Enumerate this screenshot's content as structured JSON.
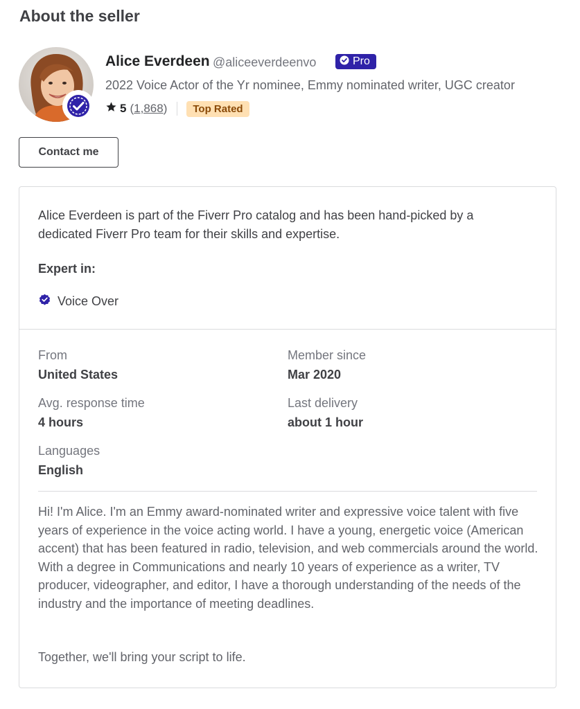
{
  "section_title": "About the seller",
  "seller": {
    "name": "Alice Everdeen",
    "handle": "@aliceeverdeenvo",
    "pro_label": "Pro",
    "tagline": "2022 Voice Actor of the Yr nominee, Emmy nominated writer, UGC creator",
    "rating": "5",
    "review_count": "1,868",
    "badge": "Top Rated",
    "icons": {
      "star": "star-icon",
      "verified": "verified-check-icon",
      "avatar": "avatar-photo"
    }
  },
  "contact_button": "Contact me",
  "card": {
    "intro": "Alice Everdeen is part of the Fiverr Pro catalog and has been hand-picked by a dedicated Fiverr Pro team for their skills and expertise.",
    "expert_title": "Expert in:",
    "skills": [
      "Voice Over"
    ],
    "stats": {
      "from_label": "From",
      "from_value": "United States",
      "member_label": "Member since",
      "member_value": "Mar 2020",
      "response_label": "Avg. response time",
      "response_value": "4 hours",
      "delivery_label": "Last delivery",
      "delivery_value": "about 1 hour",
      "languages_label": "Languages",
      "languages_value": "English"
    },
    "bio": "Hi! I'm Alice. I'm an Emmy award-nominated writer and expressive voice talent with five years of experience in the voice acting world. I have a young, energetic voice (American accent) that has been featured in radio, television, and web commercials around the world. With a degree in Communications and nearly 10 years of experience as a writer, TV producer, videographer, and editor, I have a thorough understanding of the needs of the industry and the importance of meeting deadlines.",
    "closing": "Together, we'll bring your script to life."
  },
  "colors": {
    "pro": "#2f22a8",
    "top_rated_bg": "#ffe0b3",
    "text": "#404145",
    "muted": "#74767e"
  }
}
